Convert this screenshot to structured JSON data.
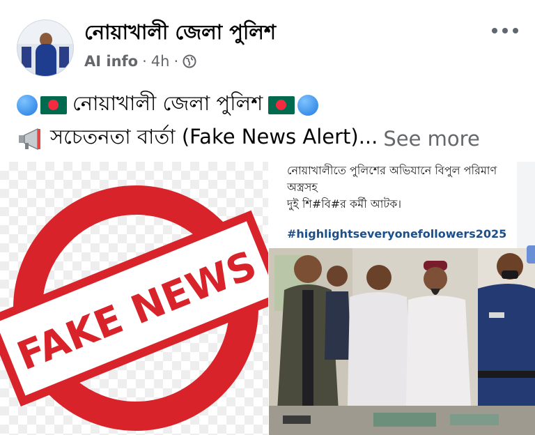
{
  "post": {
    "page_name": "নোয়াখালী জেলা পুলিশ",
    "author_label": "AI info",
    "separator": "·",
    "time": "4h",
    "privacy_icon": "globe-icon",
    "more_icon": "more-options-icon",
    "text_line1": "নোয়াখালী জেলা পুলিশ",
    "text_line2": "সচেতনতা বার্তা (Fake News Alert)...",
    "see_more": "See more"
  },
  "images": {
    "left": {
      "stamp_text": "FAKE NEWS",
      "stamp_color": "#d9232a"
    },
    "right": {
      "caption_line1": "নোয়াখালীতে পুলিশের অভিযানে বিপুল পরিমাণ",
      "caption_line2": "অস্ত্রসহ",
      "caption_line3": "দুই শি#বি#র কর্মী আটক।",
      "hashtag": "#highlightseveryonefollowers2025"
    }
  },
  "colors": {
    "text": "#050505",
    "meta": "#65676b",
    "hashtag": "#1c4f8a"
  }
}
